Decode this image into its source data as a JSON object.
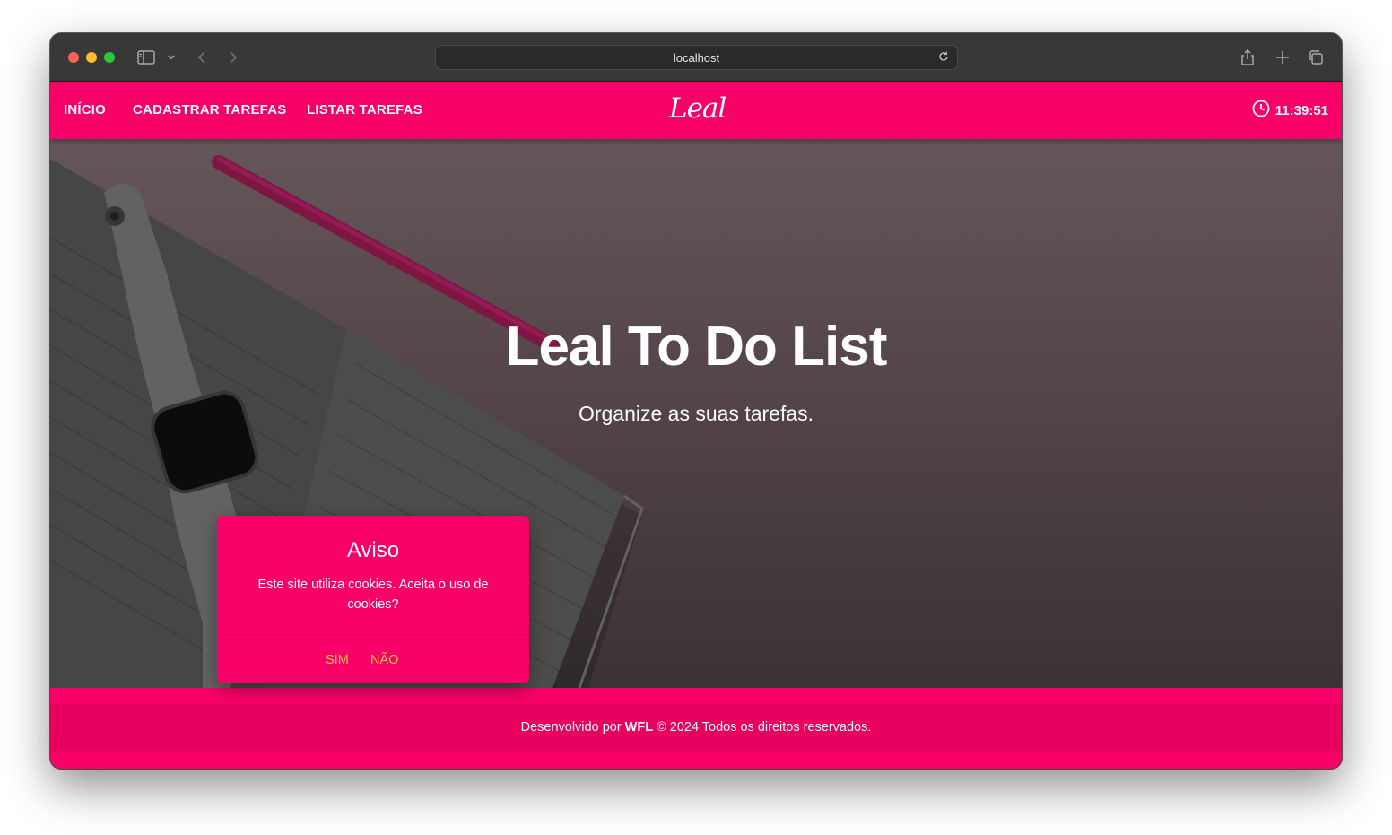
{
  "browser": {
    "url": "localhost"
  },
  "nav": {
    "links": [
      "INÍCIO",
      "CADASTRAR TAREFAS",
      "LISTAR TAREFAS"
    ],
    "brand": "Leal",
    "clock_time": "11:39:51"
  },
  "hero": {
    "title": "Leal To Do List",
    "subtitle": "Organize as suas tarefas."
  },
  "cookie_modal": {
    "title": "Aviso",
    "message": "Este site utiliza cookies. Aceita o uso de cookies?",
    "accept_label": "SIM",
    "decline_label": "NÃO"
  },
  "footer": {
    "prefix": "Desenvolvido por",
    "author": "WFL",
    "suffix": "© 2024 Todos os direitos reservados."
  },
  "colors": {
    "brand_pink": "#f70068",
    "modal_button": "#ffc845"
  }
}
